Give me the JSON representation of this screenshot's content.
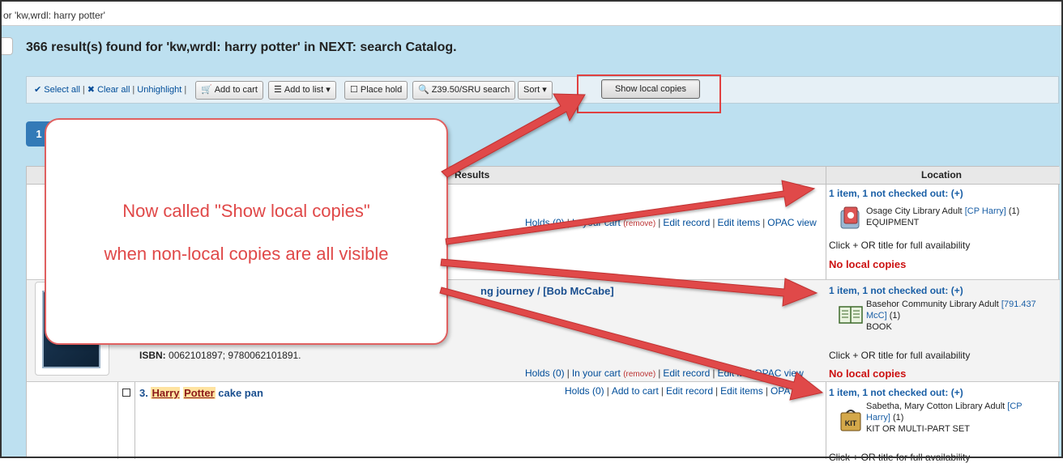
{
  "window": {
    "title": "or 'kw,wrdl: harry potter'"
  },
  "heading": "366 result(s) found for 'kw,wrdl: harry potter' in NEXT: search Catalog.",
  "toolbar": {
    "select_all": "Select all",
    "sep1": "|",
    "clear_all": "Clear all",
    "sep2": "|",
    "unhighlight": "Unhighlight",
    "sep3": "|",
    "add_to_cart": "Add to cart",
    "add_to_list": "Add to list",
    "place_hold": "Place hold",
    "z3950": "Z39.50/SRU search",
    "sort": "Sort",
    "show_local": "Show local copies"
  },
  "pagination": {
    "current": "1"
  },
  "table": {
    "col_results": "Results",
    "col_location": "Location"
  },
  "rows": [
    {
      "links": {
        "holds": "Holds (0)",
        "in_cart": "In your cart",
        "remove": "(remove)",
        "edit_record": "Edit record",
        "edit_items": "Edit items",
        "opac": "OPAC view"
      },
      "availability": "1 item, 1 not checked out: (+)",
      "library": "Osage City Library Adult",
      "call_number": "[CP Harry]",
      "count": "(1)",
      "item_type": "EQUIPMENT",
      "full_note": "Click + OR title for full availability",
      "no_local": "No local copies"
    },
    {
      "title_visible": "ng journey / [Bob McCabe]",
      "isbn_label": "ISBN:",
      "isbn": "0062101897; 9780062101891.",
      "links": {
        "holds": "Holds (0)",
        "in_cart": "In your cart",
        "remove": "(remove)",
        "edit_record": "Edit record",
        "edit_items": "Edit ite",
        "opac": "OPAC view"
      },
      "availability": "1 item, 1 not checked out: (+)",
      "library": "Basehor Community Library Adult",
      "call_number_a": "[791.437",
      "call_number_b": "McC]",
      "count": "(1)",
      "item_type": "BOOK",
      "full_note": "Click + OR title for full availability",
      "no_local": "No local copies"
    },
    {
      "number": "3.",
      "title_word1": "Harry",
      "title_word2": "Potter",
      "title_rest": "cake pan",
      "links": {
        "holds": "Holds (0)",
        "add_cart": "Add to cart",
        "edit_record": "Edit record",
        "edit_items": "Edit items",
        "opac": "OPA"
      },
      "availability": "1 item, 1 not checked out: (+)",
      "library": "Sabetha, Mary Cotton Library Adult",
      "call_number_a": "[CP",
      "call_number_b": "Harry]",
      "count": "(1)",
      "item_type": "KIT OR MULTI-PART SET",
      "full_note": "Click + OR title for full availability"
    }
  ],
  "callout": {
    "line1": "Now called \"Show local copies\"",
    "line2": "when non-local copies are all visible"
  },
  "icons": {
    "equipment": "equipment-icon",
    "book": "book-icon",
    "kit": "kit-icon",
    "kit_label": "KIT"
  },
  "colors": {
    "annotation_red": "#e04848",
    "link_blue": "#004d99",
    "no_local_red": "#cc1111",
    "page_bg": "#bde0f0"
  }
}
